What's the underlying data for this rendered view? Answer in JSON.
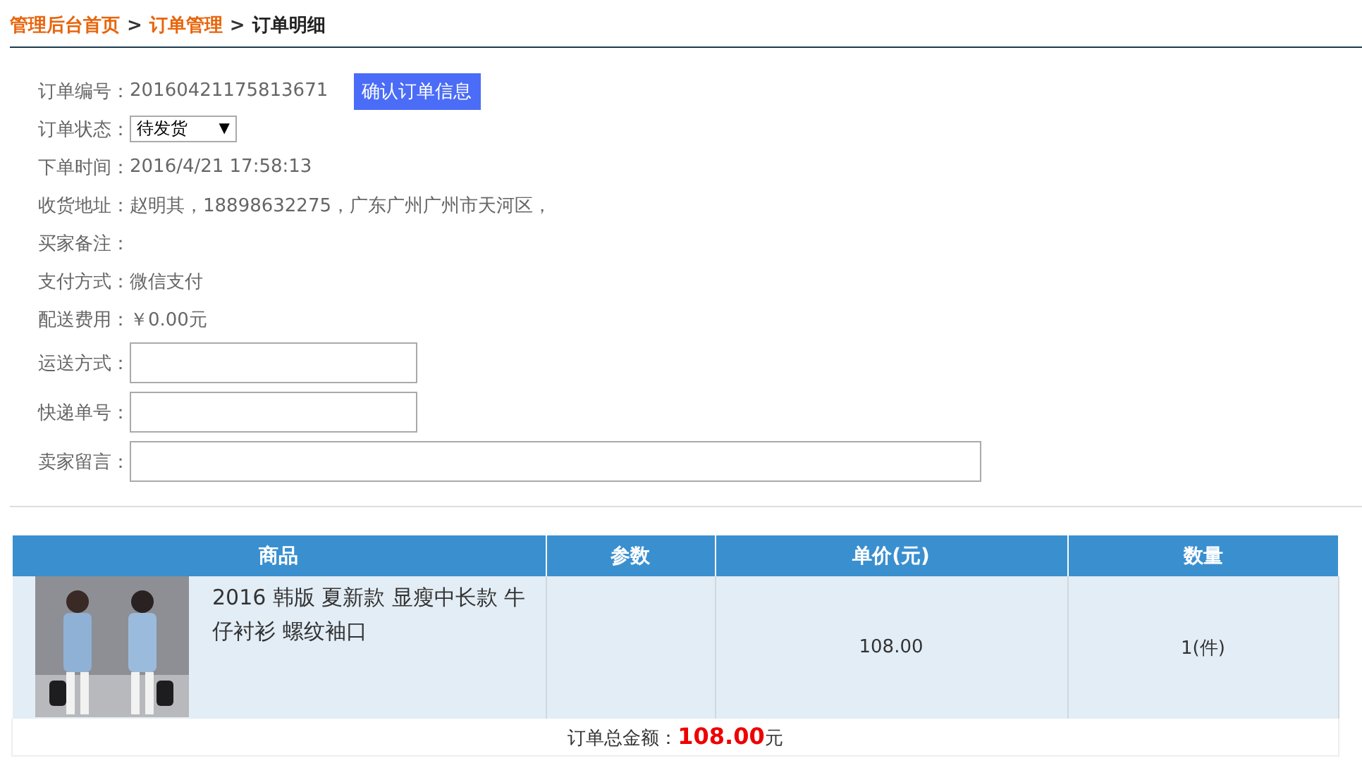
{
  "breadcrumb": [
    {
      "label": "管理后台首页",
      "kind": "link"
    },
    {
      "label": ">",
      "kind": "sep"
    },
    {
      "label": "订单管理",
      "kind": "link"
    },
    {
      "label": ">",
      "kind": "sep"
    },
    {
      "label": "订单明细",
      "kind": "current"
    }
  ],
  "fields": [
    {
      "kind": "text",
      "label": "订单编号：",
      "value": "20160421175813671",
      "button": "确认订单信息"
    },
    {
      "kind": "select",
      "label": "订单状态：",
      "value": "待发货",
      "caret": "▼"
    },
    {
      "kind": "text",
      "label": "下单时间：",
      "value": "2016/4/21 17:58:13"
    },
    {
      "kind": "text",
      "label": "收货地址：",
      "value": "赵明其，18898632275，广东广州广州市天河区，"
    },
    {
      "kind": "text",
      "label": "买家备注："
    },
    {
      "kind": "text",
      "label": "支付方式：",
      "value": "微信支付"
    },
    {
      "kind": "text",
      "label": "配送费用：",
      "value": "￥0.00元"
    },
    {
      "kind": "input",
      "label": "运送方式："
    },
    {
      "kind": "input",
      "label": "快递单号："
    },
    {
      "kind": "wide-input",
      "label": "卖家留言："
    }
  ],
  "table": {
    "columns": [
      "商品",
      "参数",
      "单价(元)",
      "数量"
    ],
    "rows": [
      {
        "name": "2016 韩版 夏新款 显瘦中长款 牛仔衬衫 螺纹袖口",
        "price": "108.00",
        "quantity": "1(件)"
      }
    ],
    "total": "订单总金额：**108.00**元"
  }
}
